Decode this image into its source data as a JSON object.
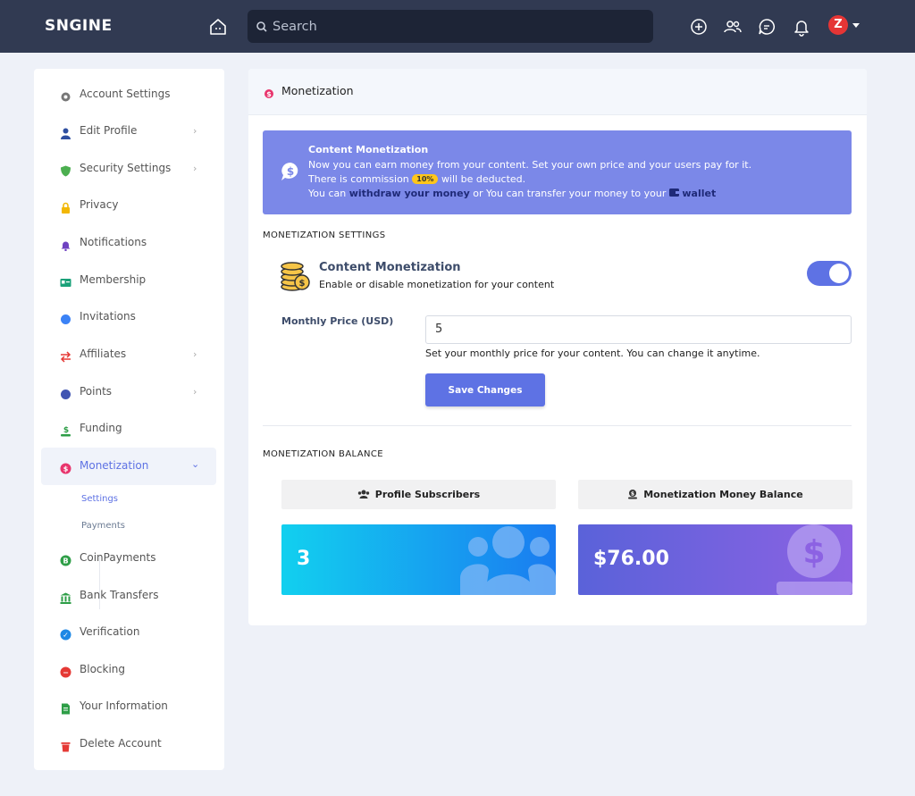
{
  "topbar": {
    "logo": "SNGINE",
    "search_placeholder": "Search",
    "avatar_letter": "Z"
  },
  "sidebar": {
    "items": [
      {
        "label": "Account Settings",
        "icon": "gear-icon"
      },
      {
        "label": "Edit Profile",
        "icon": "user-icon",
        "chevron": true
      },
      {
        "label": "Security Settings",
        "icon": "shield-icon",
        "chevron": true
      },
      {
        "label": "Privacy",
        "icon": "lock-icon"
      },
      {
        "label": "Notifications",
        "icon": "bell-icon"
      },
      {
        "label": "Membership",
        "icon": "id-card-icon"
      },
      {
        "label": "Invitations",
        "icon": "handshake-icon"
      },
      {
        "label": "Affiliates",
        "icon": "exchange-icon",
        "chevron": true
      },
      {
        "label": "Points",
        "icon": "piggy-bank-icon",
        "chevron": true
      },
      {
        "label": "Funding",
        "icon": "hand-dollar-icon"
      },
      {
        "label": "Monetization",
        "icon": "money-bubble-icon",
        "active": true
      },
      {
        "label": "CoinPayments",
        "icon": "bitcoin-icon"
      },
      {
        "label": "Bank Transfers",
        "icon": "bank-icon"
      },
      {
        "label": "Verification",
        "icon": "check-circle-icon"
      },
      {
        "label": "Blocking",
        "icon": "minus-circle-icon"
      },
      {
        "label": "Your Information",
        "icon": "document-icon"
      },
      {
        "label": "Delete Account",
        "icon": "trash-icon"
      }
    ],
    "subitems": [
      {
        "label": "Settings",
        "active": true
      },
      {
        "label": "Payments"
      }
    ]
  },
  "main": {
    "title": "Monetization",
    "alert": {
      "title": "Content Monetization",
      "line1": "Now you can earn money from your content. Set your own price and your users pay for it.",
      "line2_pre": "There is commission",
      "badge": "10%",
      "line2_post": "will be deducted.",
      "line3_pre": "You can",
      "withdraw_link": "withdraw your money",
      "line3_mid": "or You can transfer your money to your",
      "wallet_link": "wallet"
    },
    "settings_heading": "MONETIZATION SETTINGS",
    "toggle": {
      "title": "Content Monetization",
      "description": "Enable or disable monetization for your content",
      "enabled": true
    },
    "price_label": "Monthly Price (USD)",
    "price_value": "5",
    "price_hint": "Set your monthly price for your content. You can change it anytime.",
    "save_label": "Save Changes",
    "balance_heading": "MONETIZATION BALANCE",
    "subscribers": {
      "label": "Profile Subscribers",
      "value": "3"
    },
    "balance": {
      "label": "Monetization Money Balance",
      "value": "$76.00"
    }
  },
  "colors": {
    "topbar": "#313a52",
    "accent": "#5e72e4",
    "alert_bg": "#7b88e8",
    "badge": "#ffc61a"
  }
}
